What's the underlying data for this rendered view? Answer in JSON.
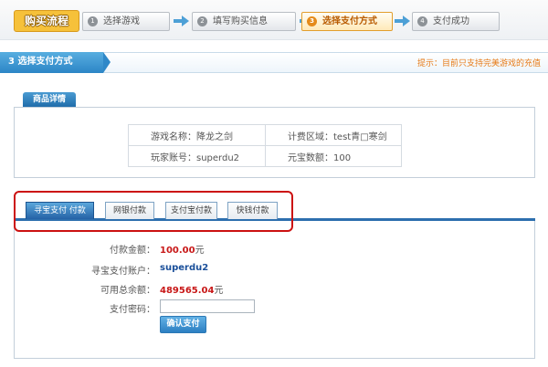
{
  "steps": {
    "brand": "购买流程",
    "items": [
      {
        "num": "1",
        "label": "选择游戏"
      },
      {
        "num": "2",
        "label": "填写购买信息"
      },
      {
        "num": "3",
        "label": "选择支付方式"
      },
      {
        "num": "4",
        "label": "支付成功"
      }
    ],
    "accent_color": "#e58b1a"
  },
  "section": {
    "title": "3 选择支付方式",
    "tip": "提示：目前只支持完美游戏的充值"
  },
  "product": {
    "tab": "商品详情",
    "rows": [
      [
        "游戏名称：降龙之剑",
        "计费区域：test青□寒剑"
      ],
      [
        "玩家账号：superdu2",
        "元宝数额：100"
      ]
    ]
  },
  "payment": {
    "tabs": [
      "寻宝支付 付款",
      "网银付款",
      "支付宝付款",
      "快钱付款"
    ],
    "amount_label": "付款金额：",
    "amount_value": "100.00",
    "amount_unit": "元",
    "account_label": "寻宝支付账户：",
    "account_value": "superdu2",
    "balance_label": "可用总余额：",
    "balance_value": "489565.04",
    "balance_unit": "元",
    "password_label": "支付密码：",
    "password_value": "",
    "confirm_label": "确认支付"
  }
}
